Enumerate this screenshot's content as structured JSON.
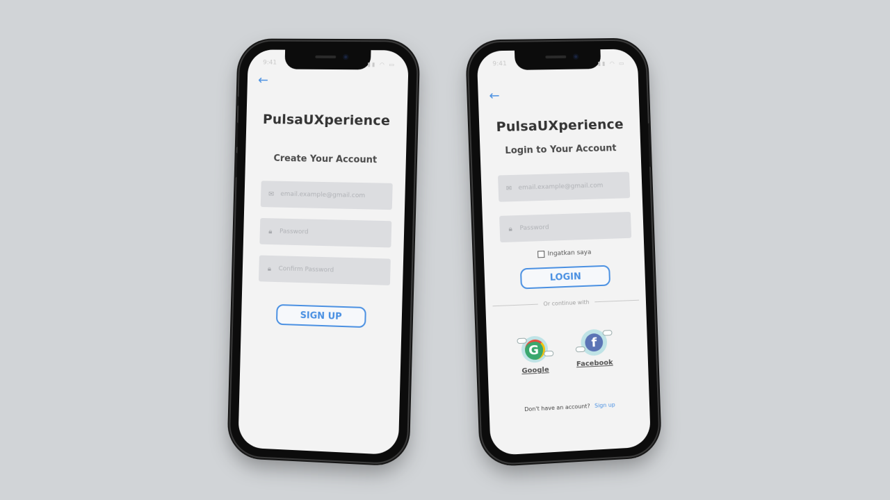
{
  "signup_screen": {
    "status_time": "9:41",
    "brand": "PulsaUXperience",
    "title": "Create Your Account",
    "email_placeholder": "email.example@gmail.com",
    "password_placeholder": "Password",
    "confirm_placeholder": "Confirm Password",
    "signup_label": "SIGN UP"
  },
  "login_screen": {
    "status_time": "9:41",
    "brand": "PulsaUXperience",
    "title": "Login to Your Account",
    "email_placeholder": "email.example@gmail.com",
    "password_placeholder": "Password",
    "remember_label": "Ingatkan saya",
    "login_label": "LOGIN",
    "divider_text": "Or continue with",
    "google_label": "Google",
    "facebook_label": "Facebook",
    "no_account_text": "Don't have an account?",
    "signup_link": "Sign up"
  },
  "icons": {
    "back": "arrow-left-icon",
    "email": "mail-icon",
    "lock": "lock-icon",
    "google": "google-icon",
    "facebook": "facebook-icon"
  },
  "colors": {
    "accent": "#4a90e2",
    "field_bg": "#dcdde0",
    "screen_bg": "#f3f3f3",
    "page_bg": "#d1d4d7"
  }
}
